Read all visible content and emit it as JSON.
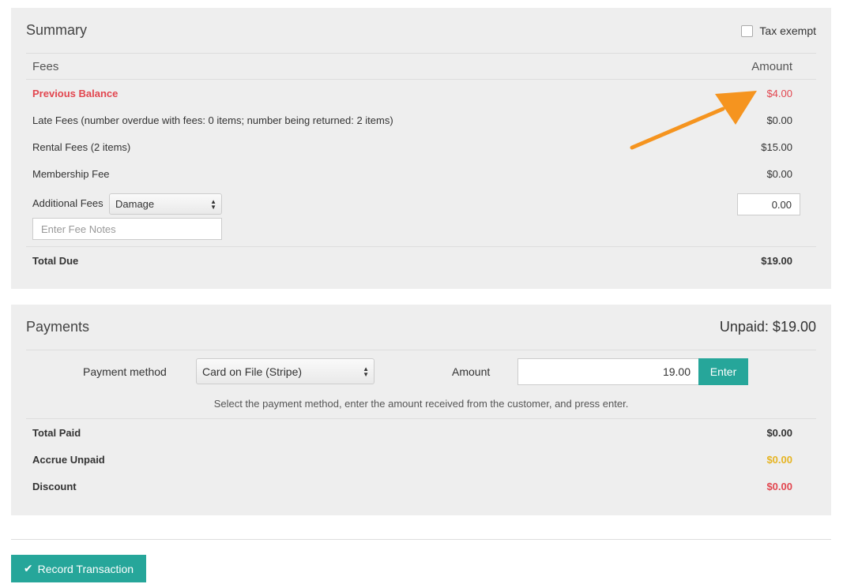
{
  "summary": {
    "title": "Summary",
    "tax_exempt_label": "Tax exempt",
    "fees_header": "Fees",
    "amount_header": "Amount",
    "rows": [
      {
        "label": "Previous Balance",
        "amount": "$4.00"
      },
      {
        "label": "Late Fees (number overdue with fees: 0 items; number being returned: 2 items)",
        "amount": "$0.00"
      },
      {
        "label": "Rental Fees (2 items)",
        "amount": "$15.00"
      },
      {
        "label": "Membership Fee",
        "amount": "$0.00"
      }
    ],
    "additional_fees_label": "Additional Fees",
    "additional_fees_type": "Damage",
    "additional_fees_amount": "0.00",
    "fee_notes_placeholder": "Enter Fee Notes",
    "total_due_label": "Total Due",
    "total_due_amount": "$19.00"
  },
  "payments": {
    "title": "Payments",
    "unpaid_label": "Unpaid: $19.00",
    "method_label": "Payment method",
    "method_value": "Card on File (Stripe)",
    "amount_label": "Amount",
    "amount_value": "19.00",
    "enter_label": "Enter",
    "hint": "Select the payment method, enter the amount received from the customer, and press enter.",
    "totals": [
      {
        "label": "Total Paid",
        "amount": "$0.00"
      },
      {
        "label": "Accrue Unpaid",
        "amount": "$0.00"
      },
      {
        "label": "Discount",
        "amount": "$0.00"
      }
    ]
  },
  "record_button_label": "Record Transaction",
  "colors": {
    "accent": "#26a69a",
    "red": "#e2464f",
    "amber": "#e6b422",
    "annotation_arrow": "#f5941f"
  },
  "icons": {
    "record_button": "checkmark-icon",
    "select_arrows": "sort-arrows-icon"
  }
}
